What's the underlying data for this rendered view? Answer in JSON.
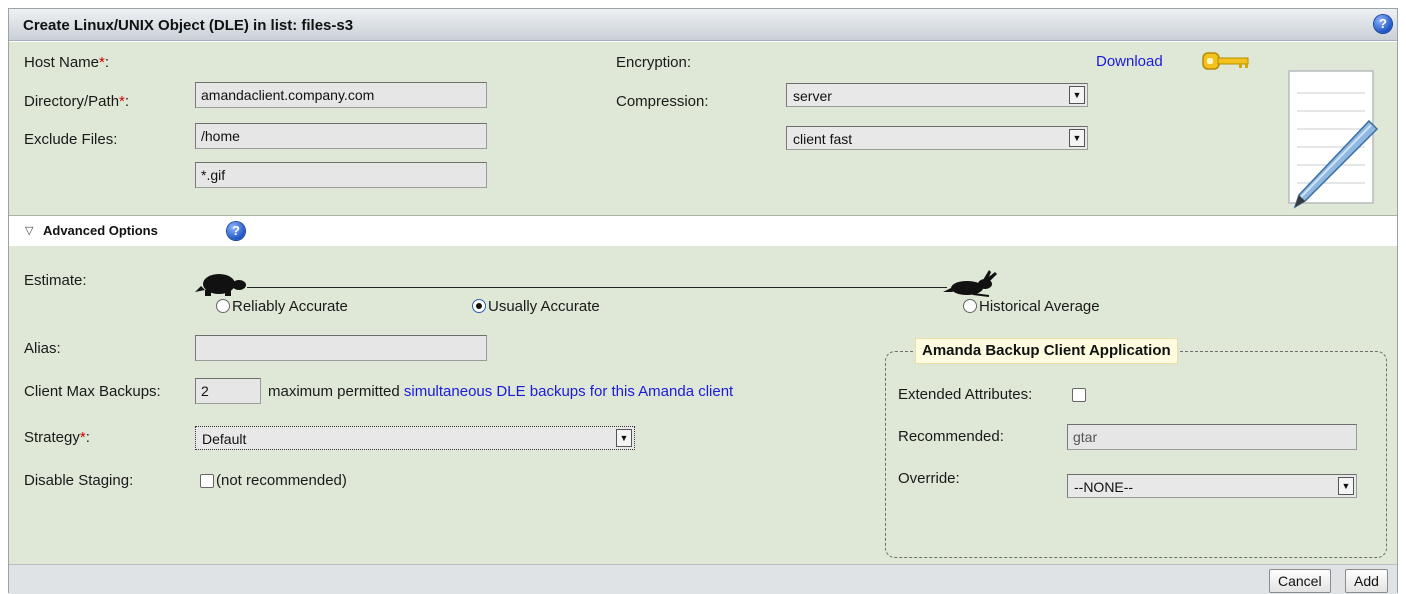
{
  "header": {
    "title": "Create Linux/UNIX Object (DLE) in list: files-s3"
  },
  "form": {
    "host_name": {
      "label": "Host Name",
      "required": "*",
      "colon": ":",
      "value": "amandaclient.company.com"
    },
    "directory": {
      "label": "Directory/Path",
      "required": "*",
      "colon": ":",
      "value": "/home"
    },
    "exclude": {
      "label": "Exclude Files:",
      "value": "*.gif"
    },
    "encryption": {
      "label": "Encryption:",
      "value": "server"
    },
    "compression": {
      "label": "Compression:",
      "value": "client fast"
    },
    "download": {
      "label": "Download"
    }
  },
  "advanced": {
    "label": "Advanced Options",
    "estimate": {
      "label": "Estimate:",
      "options": [
        "Reliably Accurate",
        "Usually Accurate",
        "Historical Average"
      ],
      "selected": "Usually Accurate"
    },
    "alias": {
      "label": "Alias:",
      "value": ""
    },
    "client_max_backups": {
      "label": "Client Max Backups:",
      "value": "2",
      "desc_prefix": "maximum permitted",
      "desc_link": "simultaneous DLE backups for this Amanda client"
    },
    "strategy": {
      "label": "Strategy",
      "required": "*",
      "colon": ":",
      "value": "Default"
    },
    "disable_staging": {
      "label": "Disable Staging:",
      "note": "(not recommended)",
      "checked": false
    }
  },
  "client_app": {
    "legend": "Amanda Backup Client Application",
    "extended_attributes": {
      "label": "Extended Attributes:",
      "checked": false
    },
    "recommended": {
      "label": "Recommended:",
      "value": "gtar"
    },
    "override": {
      "label": "Override:",
      "value": "--NONE--"
    }
  },
  "footer": {
    "cancel": "Cancel",
    "add": "Add"
  },
  "colors": {
    "panel_bg": "#dfe8d6",
    "link": "#1a1add",
    "required": "#d00000"
  }
}
